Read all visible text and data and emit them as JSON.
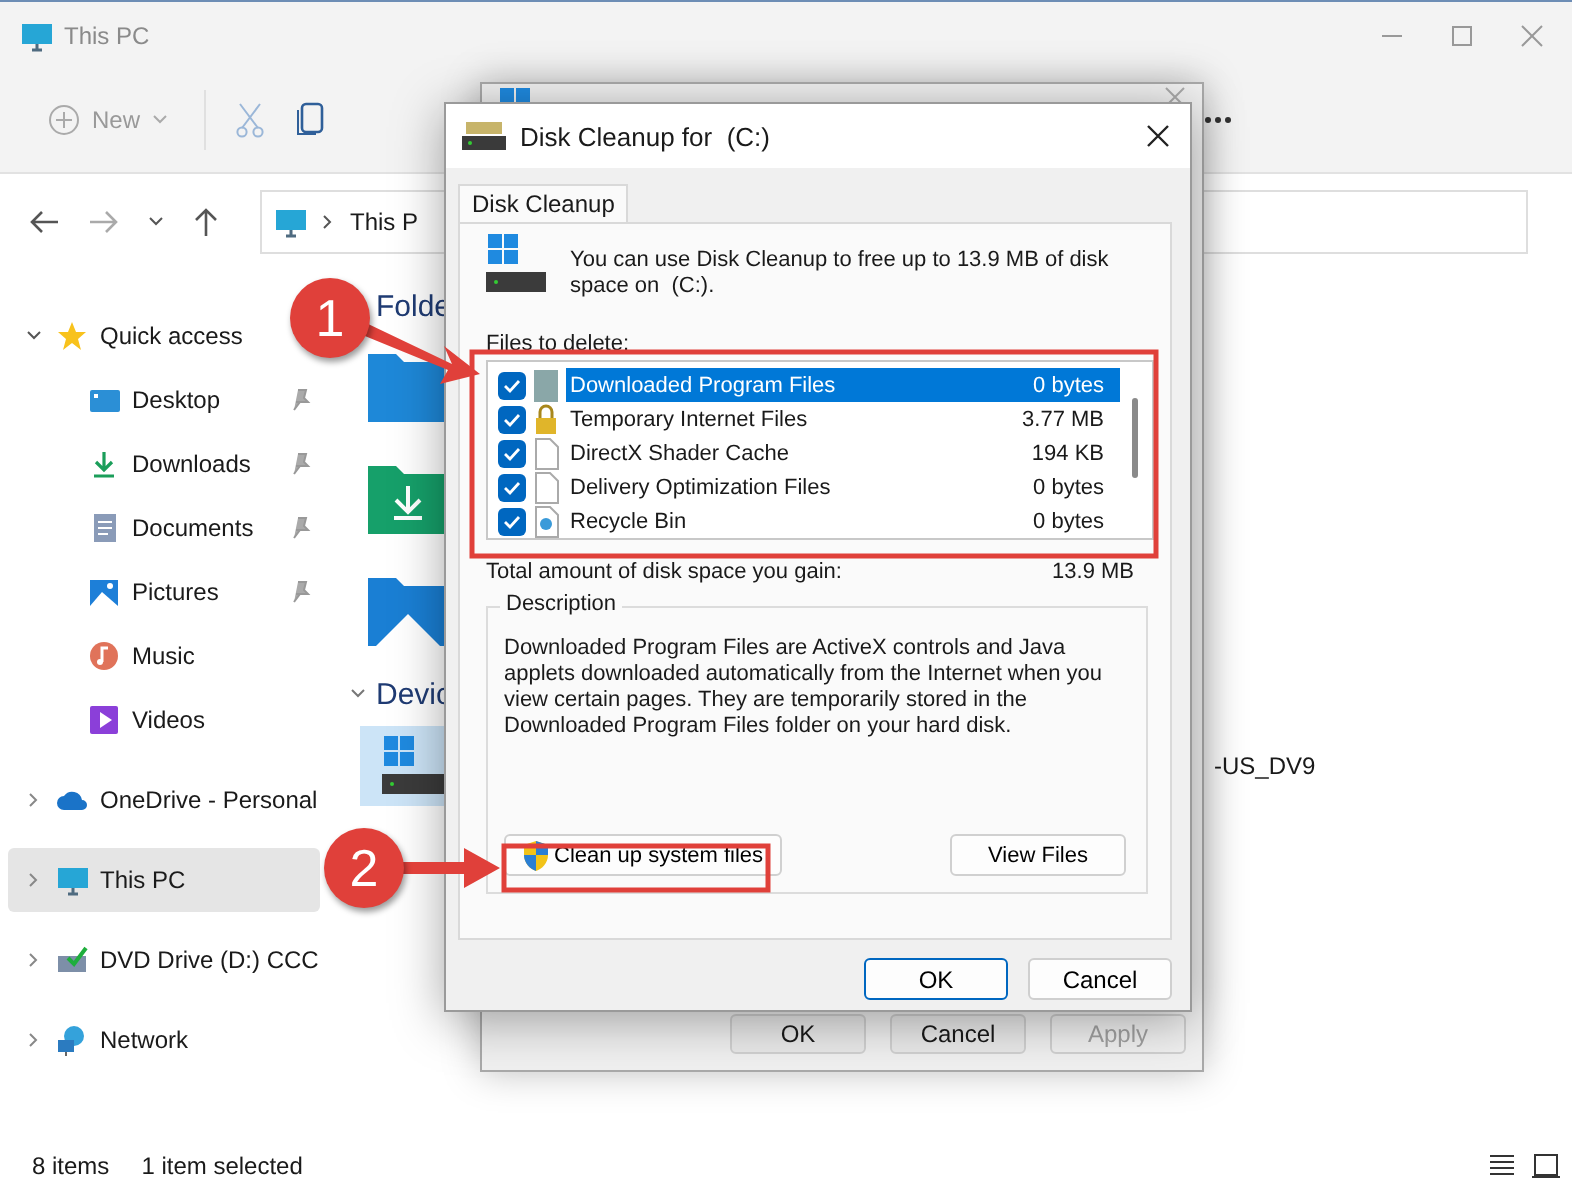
{
  "explorer": {
    "title": "This PC",
    "toolbar": {
      "new_label": "New"
    },
    "address": {
      "crumb": "This P"
    },
    "sidebar": [
      {
        "label": "Quick access",
        "kind": "star",
        "expanded": true,
        "selected": false,
        "children": [
          {
            "label": "Desktop",
            "kind": "desktop",
            "pinned": true,
            "selected": false
          },
          {
            "label": "Downloads",
            "kind": "download",
            "pinned": true,
            "selected": false
          },
          {
            "label": "Documents",
            "kind": "documents",
            "pinned": true,
            "selected": false
          },
          {
            "label": "Pictures",
            "kind": "pictures",
            "pinned": true,
            "selected": false
          },
          {
            "label": "Music",
            "kind": "music",
            "pinned": false,
            "selected": false
          },
          {
            "label": "Videos",
            "kind": "videos",
            "pinned": false,
            "selected": false
          }
        ]
      },
      {
        "label": "OneDrive - Personal",
        "kind": "cloud",
        "expanded": false,
        "selected": false
      },
      {
        "label": "This PC",
        "kind": "pc",
        "expanded": false,
        "selected": true
      },
      {
        "label": "DVD Drive (D:) CCC",
        "kind": "dvd",
        "expanded": false,
        "selected": false
      },
      {
        "label": "Network",
        "kind": "network",
        "expanded": false,
        "selected": false
      }
    ],
    "sections": [
      {
        "title": "Folde",
        "items": [
          {
            "kind": "desktop"
          },
          {
            "kind": "download"
          },
          {
            "kind": "pictures"
          }
        ]
      },
      {
        "title": "Devic",
        "expanded": true,
        "items": [
          {
            "kind": "drive",
            "selected": true
          },
          {
            "label": "-US_DV9",
            "selected": false
          }
        ]
      }
    ],
    "status_bar": {
      "count": "8 items",
      "selection": "1 item selected"
    }
  },
  "properties": {
    "buttons": [
      {
        "label": "OK",
        "disabled": false
      },
      {
        "label": "Cancel",
        "disabled": false
      },
      {
        "label": "Apply",
        "disabled": true
      }
    ]
  },
  "cleanup": {
    "title": "Disk Cleanup for  (C:)",
    "tabs": [
      {
        "label": "Disk Cleanup",
        "selected": true
      }
    ],
    "intro": "You can use Disk Cleanup to free up to 13.9 MB of disk space on  (C:).",
    "files_label": "Files to delete:",
    "files": [
      {
        "label": "Downloaded Program Files",
        "size": "0 bytes",
        "checked": true,
        "selected": true,
        "kind": "folder"
      },
      {
        "label": "Temporary Internet Files",
        "size": "3.77 MB",
        "checked": true,
        "selected": false,
        "kind": "lock"
      },
      {
        "label": "DirectX Shader Cache",
        "size": "194 KB",
        "checked": true,
        "selected": false,
        "kind": "page"
      },
      {
        "label": "Delivery Optimization Files",
        "size": "0 bytes",
        "checked": true,
        "selected": false,
        "kind": "page"
      },
      {
        "label": "Recycle Bin",
        "size": "0 bytes",
        "checked": true,
        "selected": false,
        "kind": "bin"
      }
    ],
    "total_label": "Total amount of disk space you gain:",
    "total": "13.9 MB",
    "description": {
      "title": "Description",
      "text": "Downloaded Program Files are ActiveX controls and Java applets downloaded automatically from the Internet when you view certain pages. They are temporarily stored in the Downloaded Program Files folder on your hard disk."
    },
    "buttons": [
      {
        "label": "Clean up system files",
        "kind": "shield"
      },
      {
        "label": "View Files",
        "kind": "plain"
      }
    ],
    "footer_buttons": [
      {
        "label": "OK",
        "default": true
      },
      {
        "label": "Cancel",
        "default": false
      }
    ]
  },
  "annotations": [
    {
      "number": "1"
    },
    {
      "number": "2"
    }
  ]
}
